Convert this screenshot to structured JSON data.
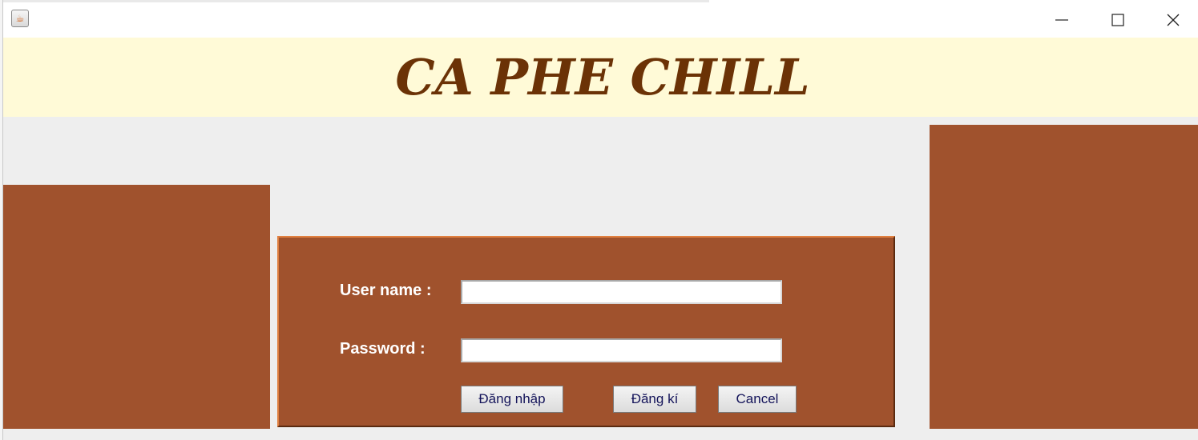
{
  "window": {
    "icon": "java-cup-icon",
    "controls": [
      "minimize-icon",
      "maximize-icon",
      "close-icon"
    ]
  },
  "header": {
    "title": "CA PHE CHILL"
  },
  "login": {
    "username_label": "User name :",
    "username_value": "",
    "password_label": "Password :",
    "password_value": "",
    "login_button": "Đăng nhập",
    "register_button": "Đăng kí",
    "cancel_button": "Cancel"
  },
  "colors": {
    "header_bg": "#fffad7",
    "title_text": "#6b3206",
    "panel_brown": "#a0522d",
    "content_bg": "#eeeeee",
    "button_text": "#14145a"
  }
}
